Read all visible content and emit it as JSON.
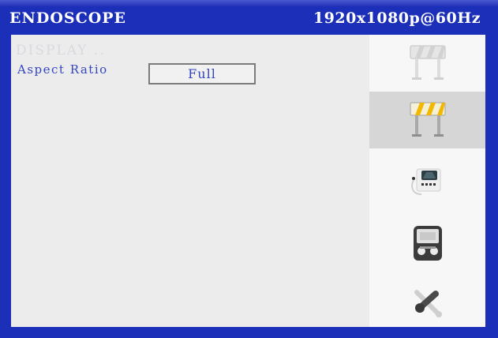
{
  "header": {
    "app_title": "ENDOSCOPE",
    "resolution": "1920x1080p@60Hz"
  },
  "menu": {
    "section_title": "DISPLAY ..",
    "aspect_ratio_label": "Aspect Ratio",
    "aspect_ratio_value": "Full"
  },
  "sidebar": {
    "items": [
      {
        "icon": "barrier-icon-inactive",
        "selected": false
      },
      {
        "icon": "barrier-icon-active",
        "selected": true
      },
      {
        "icon": "monitor-device-icon",
        "selected": false
      },
      {
        "icon": "tv-screen-icon",
        "selected": false
      },
      {
        "icon": "tools-icon",
        "selected": false
      }
    ]
  },
  "colors": {
    "frame_blue": "#1c2fb8",
    "panel_gray": "#ececec",
    "label_blue": "#3445c0",
    "barrier_yellow": "#f2b800"
  }
}
